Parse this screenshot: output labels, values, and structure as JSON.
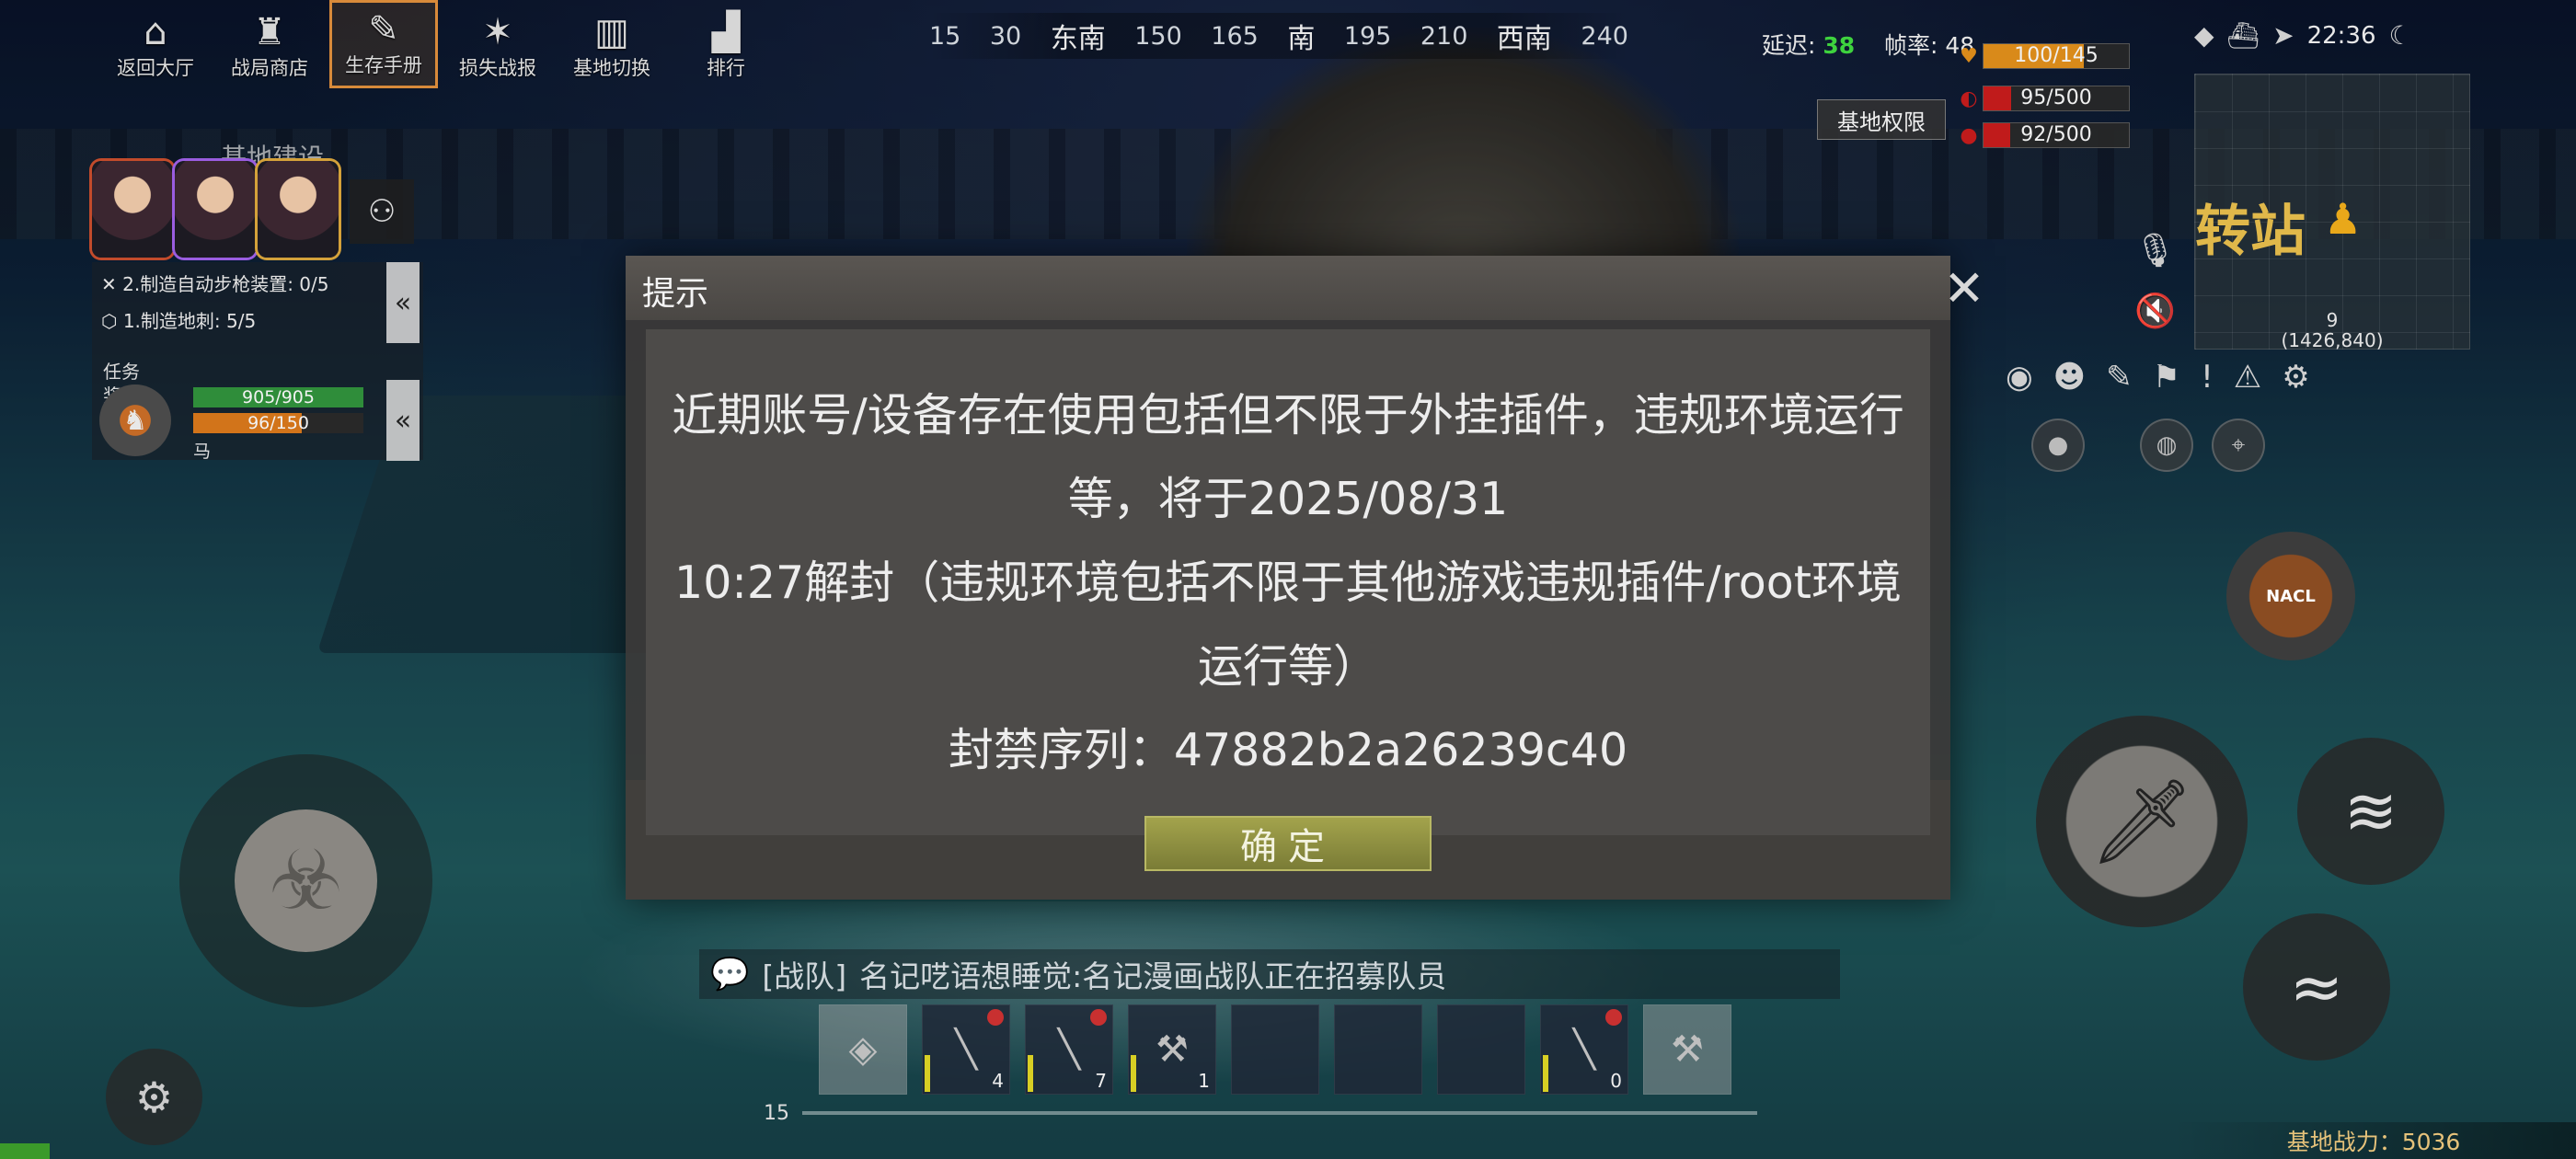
{
  "nav": {
    "items": [
      {
        "label": "返回大厅",
        "icon": "home-icon",
        "glyph": "⌂"
      },
      {
        "label": "战局商店",
        "icon": "shop-icon",
        "glyph": "♜"
      },
      {
        "label": "生存手册",
        "icon": "manual-icon",
        "glyph": "✎"
      },
      {
        "label": "损失战报",
        "icon": "battle-report-icon",
        "glyph": "✶"
      },
      {
        "label": "基地切换",
        "icon": "base-switch-icon",
        "glyph": "▥"
      },
      {
        "label": "排行",
        "icon": "ranking-icon",
        "glyph": "▟"
      }
    ],
    "active_index": 2
  },
  "compass": {
    "ticks": [
      "15",
      "30",
      "东南",
      "150",
      "165",
      "南",
      "195",
      "210",
      "西南",
      "240"
    ],
    "cardinals": [
      "东南",
      "南",
      "西南"
    ]
  },
  "net": {
    "latency_label": "延迟:",
    "latency": "38",
    "fps_label": "帧率:",
    "fps": "48"
  },
  "base_permission": "基地权限",
  "vitals": [
    {
      "text": "100/145",
      "value": 100,
      "max": 145,
      "color": "#d98a1a",
      "icon": "health-icon",
      "glyph": "♥"
    },
    {
      "text": "95/500",
      "value": 95,
      "max": 500,
      "color": "#c01b1b",
      "icon": "hunger-icon",
      "glyph": "◐"
    },
    {
      "text": "92/500",
      "value": 92,
      "max": 500,
      "color": "#c01b1b",
      "icon": "water-icon",
      "glyph": "●"
    }
  ],
  "clock": "22:36",
  "minimap": {
    "label": "转站",
    "level": "9",
    "coords": "(1426,840)"
  },
  "squad": {
    "title": "基地建设"
  },
  "quests": {
    "items": [
      "2.制造自动步枪装置: 0/5",
      "1.制造地刺: 5/5"
    ],
    "tab_label": "任务",
    "tab_label2": "奖励"
  },
  "pet": {
    "hp_text": "905/905",
    "hp": 905,
    "hp_max": 905,
    "energy_text": "96/150",
    "energy": 96,
    "energy_max": 150,
    "name": "马"
  },
  "dialog": {
    "title": "提示",
    "lines": [
      "近期账号/设备存在使用包括但不限于外挂插件，违规环境运行",
      "等，将于2025/08/31",
      "10:27解封（违规环境包括不限于其他游戏违规插件/root环境",
      "运行等）",
      "封禁序列：47882b2a26239c40"
    ],
    "confirm_label": "确定"
  },
  "chat": {
    "channel": "[战队]",
    "message": "名记呓语想睡觉:名记漫画战队正在招募队员"
  },
  "hotbar": {
    "slots": [
      {
        "type": "bag",
        "glyph": "◈",
        "count": ""
      },
      {
        "type": "weapon",
        "glyph": "╲",
        "count": "4"
      },
      {
        "type": "weapon",
        "glyph": "╲",
        "count": "7"
      },
      {
        "type": "weapon",
        "glyph": "⚒",
        "count": "1"
      },
      {
        "type": "empty",
        "glyph": "",
        "count": ""
      },
      {
        "type": "empty",
        "glyph": "",
        "count": ""
      },
      {
        "type": "empty",
        "glyph": "",
        "count": ""
      },
      {
        "type": "weapon",
        "glyph": "╲",
        "count": "0"
      },
      {
        "type": "tool",
        "glyph": "⚒",
        "count": ""
      }
    ],
    "level": "15"
  },
  "controls": {
    "nacl_label": "NACL"
  },
  "base_power": "基地战力：5036"
}
